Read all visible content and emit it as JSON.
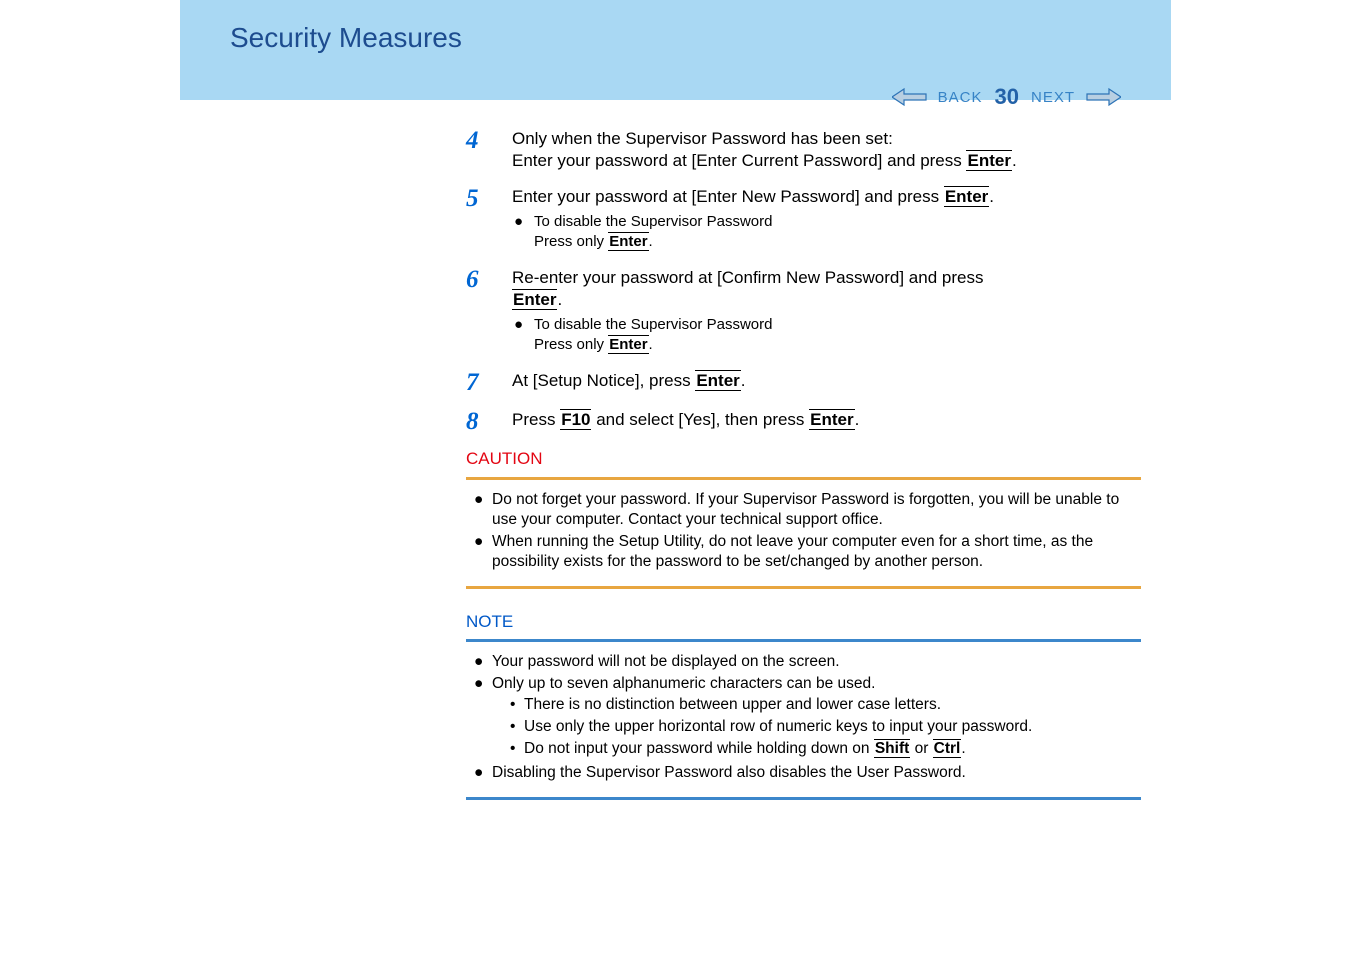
{
  "header": {
    "title": "Security Measures",
    "back_label": "BACK",
    "page_number": "30",
    "next_label": "NEXT"
  },
  "keys": {
    "enter": "Enter",
    "f10": "F10",
    "shift": "Shift",
    "ctrl": "Ctrl"
  },
  "steps": {
    "s4": {
      "num": "4",
      "line1": "Only when the Supervisor Password has been set:",
      "line2a": "Enter your password at [Enter Current Password] and press ",
      "line2b": "."
    },
    "s5": {
      "num": "5",
      "line1a": "Enter your password at [Enter New Password] and press ",
      "line1b": ".",
      "sub1": "To disable the Supervisor Password",
      "sub1b": "Press only ",
      "sub1c": "."
    },
    "s6": {
      "num": "6",
      "line1a": "Re-enter your password at [Confirm New Password] and press ",
      "line1c": ".",
      "sub1": "To disable the Supervisor Password",
      "sub1b": "Press only ",
      "sub1c": "."
    },
    "s7": {
      "num": "7",
      "line1a": "At [Setup Notice], press ",
      "line1b": "."
    },
    "s8": {
      "num": "8",
      "line1a": "Press ",
      "line1b": " and select [Yes], then press ",
      "line1c": "."
    }
  },
  "caution": {
    "label": "CAUTION",
    "items": [
      "Do not forget your password.  If your Supervisor Password is forgotten, you will be unable to use your computer. Contact your technical support office.",
      "When running the Setup Utility, do not leave your computer even for a short time, as the possibility exists for the password to be set/changed by another person."
    ]
  },
  "note": {
    "label": "NOTE",
    "i1": "Your password will not be displayed on the screen.",
    "i2": "Only up to seven alphanumeric characters can be used.",
    "i2s1": "There is no distinction between upper and lower case letters.",
    "i2s2": "Use only the upper horizontal row of numeric keys to input your password.",
    "i2s3a": "Do not input your password while holding down on ",
    "i2s3b": " or ",
    "i2s3c": ".",
    "i3": "Disabling the Supervisor Password also disables the User Password."
  }
}
